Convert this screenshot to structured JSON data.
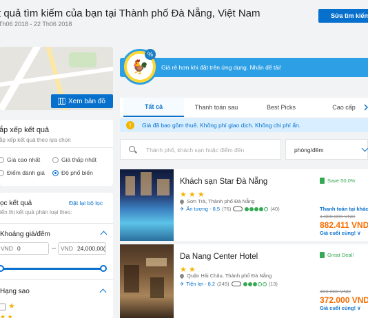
{
  "header": {
    "title": "t quả tìm kiếm của bạn tại Thành phố Đà Nẵng, Việt Nam",
    "dates": "Th06 2018 - 22 Th06 2018",
    "edit_search": "Sửa tìm kiếm"
  },
  "map": {
    "button": "Xem bản đồ",
    "icon": "map-icon"
  },
  "sort": {
    "title": "ắp xếp kết quả",
    "subtitle": "ắp xếp kết quả theo lựa chọn",
    "options": [
      {
        "label": "Giá cao nhất",
        "selected": false
      },
      {
        "label": "Giá thấp nhất",
        "selected": false
      },
      {
        "label": "Điểm đánh giá",
        "selected": false
      },
      {
        "label": "Độ phổ biến",
        "selected": true
      }
    ]
  },
  "filter": {
    "title": "ọc kết quả",
    "reset": "Đặt lại bộ lọc",
    "subtitle": "iển thị kết quả phân loại theo:",
    "price": {
      "title": "Khoảng giá/đêm",
      "min_currency": "VND",
      "min_value": "0",
      "max_currency": "VND",
      "max_value": "24,000,00(",
      "range_min_fraction": 0,
      "range_max_fraction": 1
    },
    "stars": {
      "title": "Hạng sao"
    }
  },
  "promo": {
    "text": "Giá rẻ hơn khi đặt trên ứng dụng. Nhấn để tải!",
    "badge": "%"
  },
  "tabs": [
    {
      "label": "Tất cả",
      "active": true
    },
    {
      "label": "Thanh toán sau",
      "active": false
    },
    {
      "label": "Best Picks",
      "active": false
    },
    {
      "label": "Cao cấp",
      "active": false
    }
  ],
  "info": {
    "icon": "!",
    "text": "Giá đã bao gồm thuế. Không phí giao dịch. Không chi phí ẩn."
  },
  "search": {
    "placeholder": "Thành phố, khách sạn hoặc điểm đến",
    "sort_value": "phòng/đêm"
  },
  "hotels": [
    {
      "name": "Khách sạn Star Đà Nẵng",
      "stars": 3,
      "location": "Sơn Trà, Thành phố Đà Nẵng",
      "rating_label": "Ấn tượng - 8.5",
      "rating_count": "(76)",
      "ta_bubbles": 4,
      "ta_count": "(40)",
      "deal": "Save 50.0%",
      "pay_tag": "Thanh toán tại khách",
      "old_price": "1.800.000 VND",
      "price": "882.411 VND",
      "final": "Giá cuối cùng! ∨"
    },
    {
      "name": "Da Nang Center Hotel",
      "stars": 2,
      "location": "Quận Hải Châu, Thành phố Đà Nẵng",
      "rating_label": "Tiện lợi - 8.2",
      "rating_count": "(245)",
      "ta_bubbles": 3,
      "ta_count": "(13)",
      "deal": "Great Deal!",
      "old_price": "400.000 VND",
      "price": "372.000 VND",
      "final": "Giá cuối cùng! ∨"
    }
  ],
  "colors": {
    "primary": "#0770cd",
    "promo": "#2d9fe4",
    "price": "#f96d01",
    "deal": "#34a853",
    "star": "#f5b301"
  }
}
